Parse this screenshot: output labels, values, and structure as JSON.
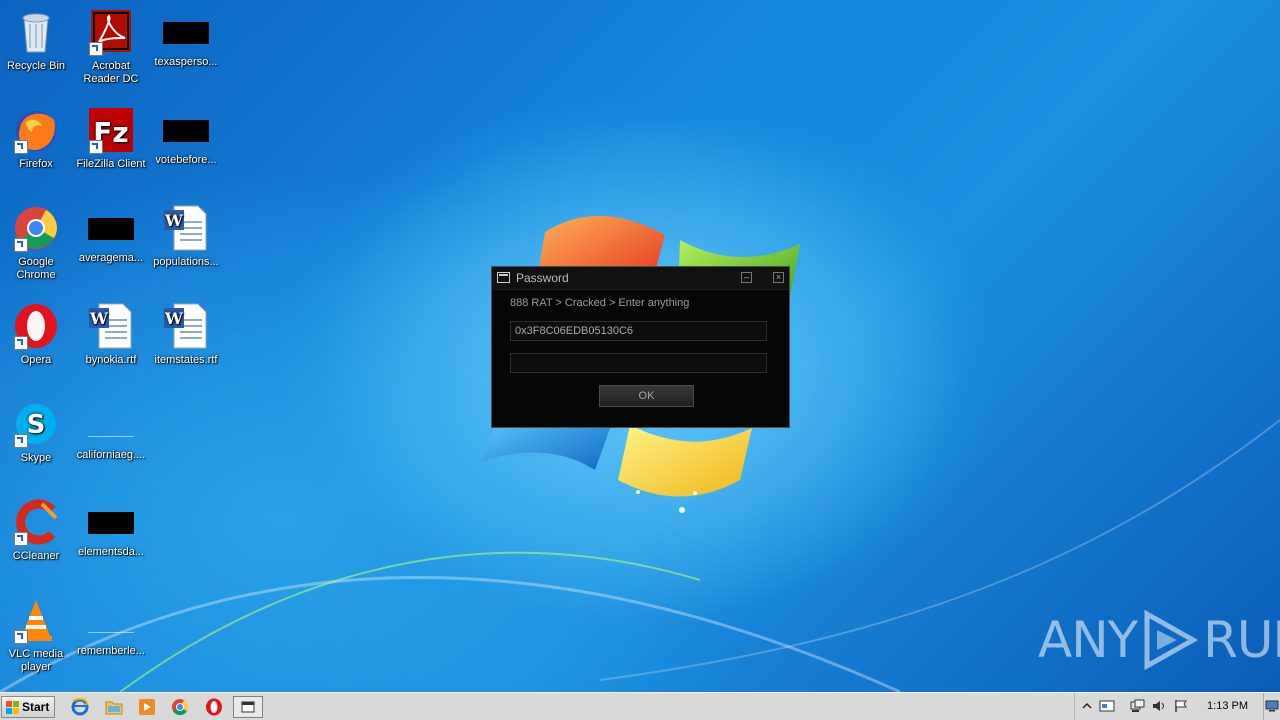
{
  "desktop_icons": [
    {
      "label": "Recycle Bin",
      "icon": "recycle-bin-icon",
      "shortcut": false
    },
    {
      "label": "Acrobat Reader DC",
      "icon": "acrobat-icon",
      "shortcut": true
    },
    {
      "label": "texasperso...",
      "icon": "redacted-icon",
      "shortcut": false
    },
    {
      "label": "Firefox",
      "icon": "firefox-icon",
      "shortcut": true
    },
    {
      "label": "FileZilla Client",
      "icon": "filezilla-icon",
      "shortcut": true
    },
    {
      "label": "votebefore...",
      "icon": "redacted-icon",
      "shortcut": false
    },
    {
      "label": "Google Chrome",
      "icon": "chrome-icon",
      "shortcut": true
    },
    {
      "label": "averagema...",
      "icon": "redacted-icon",
      "shortcut": false
    },
    {
      "label": "populations...",
      "icon": "word-document-icon",
      "shortcut": false
    },
    {
      "label": "Opera",
      "icon": "opera-icon",
      "shortcut": true
    },
    {
      "label": "bynokia.rtf",
      "icon": "word-document-icon",
      "shortcut": false
    },
    {
      "label": "itemstates.rtf",
      "icon": "word-document-icon",
      "shortcut": false
    },
    {
      "label": "Skype",
      "icon": "skype-icon",
      "shortcut": true
    },
    {
      "label": "californiaeg....",
      "icon": "blank-file-icon",
      "shortcut": false
    },
    {
      "label": "CCleaner",
      "icon": "ccleaner-icon",
      "shortcut": true
    },
    {
      "label": "elementsda...",
      "icon": "redacted-icon",
      "shortcut": false
    },
    {
      "label": "VLC media player",
      "icon": "vlc-icon",
      "shortcut": true
    },
    {
      "label": "rememberle...",
      "icon": "blank-file-icon",
      "shortcut": false
    }
  ],
  "dialog": {
    "title": "Password",
    "prompt": "888 RAT > Cracked > Enter anything",
    "hwid_value": "0x3F8C06EDB05130C6",
    "password_value": "",
    "ok_label": "OK",
    "minimize_glyph": "–",
    "close_glyph": "×"
  },
  "watermark": {
    "left": "ANY",
    "right": "RUN"
  },
  "taskbar": {
    "start_label": "Start",
    "pinned": [
      "ie-icon",
      "explorer-icon",
      "media-player-icon",
      "chrome-icon",
      "opera-icon",
      "password-window-icon"
    ],
    "tray": [
      "show-hidden-icons",
      "action-center-icon",
      "network-icon",
      "volume-icon",
      "flag-icon"
    ],
    "clock": "1:13 PM"
  }
}
